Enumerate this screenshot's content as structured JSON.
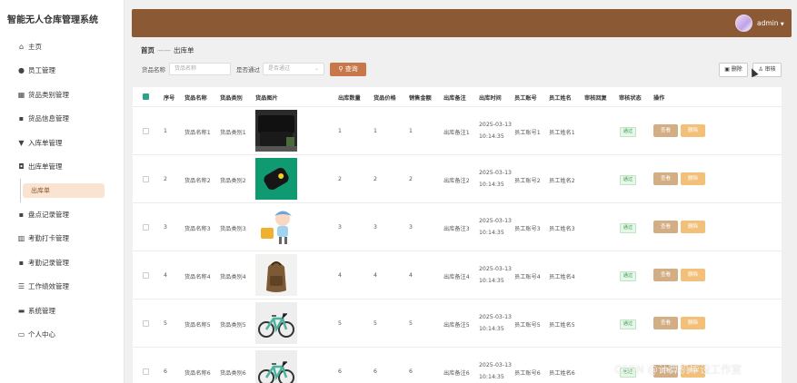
{
  "app_title": "智能无人仓库管理系统",
  "sidebar": {
    "items": [
      {
        "label": "主页",
        "icon": "home-icon"
      },
      {
        "label": "员工管理",
        "icon": "user-icon"
      },
      {
        "label": "货品类别管理",
        "icon": "category-icon"
      },
      {
        "label": "货品信息管理",
        "icon": "grid-icon"
      },
      {
        "label": "入库单管理",
        "icon": "trophy-icon"
      },
      {
        "label": "出库单管理",
        "icon": "bag-icon"
      },
      {
        "label": "盘点记录管理",
        "icon": "grid-icon"
      },
      {
        "label": "考勤打卡管理",
        "icon": "chart-icon"
      },
      {
        "label": "考勤记录管理",
        "icon": "grid-icon"
      },
      {
        "label": "工作绩效管理",
        "icon": "list-icon"
      },
      {
        "label": "系统管理",
        "icon": "trash-icon"
      },
      {
        "label": "个人中心",
        "icon": "window-icon"
      }
    ],
    "submenu_label": "出库单"
  },
  "header": {
    "username": "admin",
    "caret": "▼"
  },
  "breadcrumb": {
    "home": "首页",
    "sep": "——",
    "current": "出库单"
  },
  "filters": {
    "name_label": "货品名称",
    "name_placeholder": "货品名称",
    "pass_label": "是否通过",
    "pass_placeholder": "是否通过",
    "query_label": "查询"
  },
  "toolbar": {
    "delete_label": "删除",
    "review_label": "审核"
  },
  "table": {
    "columns": [
      "序号",
      "货品名称",
      "货品类别",
      "货品图片",
      "出库数量",
      "货品价格",
      "销售金额",
      "出库备注",
      "出库时间",
      "员工账号",
      "员工姓名",
      "审核回复",
      "审核状态",
      "操作"
    ],
    "rows": [
      {
        "no": "1",
        "name": "货品名称1",
        "category": "货品类别1",
        "qty": "1",
        "price": "1",
        "amount": "1",
        "remark": "出库备注1",
        "date": "2025-03-13",
        "time": "10:14:35",
        "account": "员工账号1",
        "staff": "员工姓名1",
        "status": "通过",
        "image": "black-bags-photo"
      },
      {
        "no": "2",
        "name": "货品名称2",
        "category": "货品类别2",
        "qty": "2",
        "price": "2",
        "amount": "2",
        "remark": "出库备注2",
        "date": "2025-03-13",
        "time": "10:14:35",
        "account": "员工账号2",
        "staff": "员工姓名2",
        "status": "通过",
        "image": "tracker-on-green-photo"
      },
      {
        "no": "3",
        "name": "货品名称3",
        "category": "货品类别3",
        "qty": "3",
        "price": "3",
        "amount": "3",
        "remark": "出库备注3",
        "date": "2025-03-13",
        "time": "10:14:35",
        "account": "员工账号3",
        "staff": "员工姓名3",
        "status": "通过",
        "image": "cartoon-girl-illustration"
      },
      {
        "no": "4",
        "name": "货品名称4",
        "category": "货品类别4",
        "qty": "4",
        "price": "4",
        "amount": "4",
        "remark": "出库备注4",
        "date": "2025-03-13",
        "time": "10:14:35",
        "account": "员工账号4",
        "staff": "员工姓名4",
        "status": "通过",
        "image": "backpack-photo"
      },
      {
        "no": "5",
        "name": "货品名称5",
        "category": "货品类别5",
        "qty": "5",
        "price": "5",
        "amount": "5",
        "remark": "出库备注5",
        "date": "2025-03-13",
        "time": "10:14:35",
        "account": "员工账号5",
        "staff": "员工姓名5",
        "status": "通过",
        "image": "bicycle-photo"
      },
      {
        "no": "6",
        "name": "货品名称6",
        "category": "货品类别6",
        "qty": "6",
        "price": "6",
        "amount": "6",
        "remark": "出库备注6",
        "date": "2025-03-13",
        "time": "10:14:35",
        "account": "员工账号6",
        "staff": "员工姓名6",
        "status": "通过",
        "image": "bicycle-photo"
      }
    ],
    "view_label": "查看",
    "delete_label": "删除"
  },
  "watermark": "CSDN @计算机毕设工作室"
}
